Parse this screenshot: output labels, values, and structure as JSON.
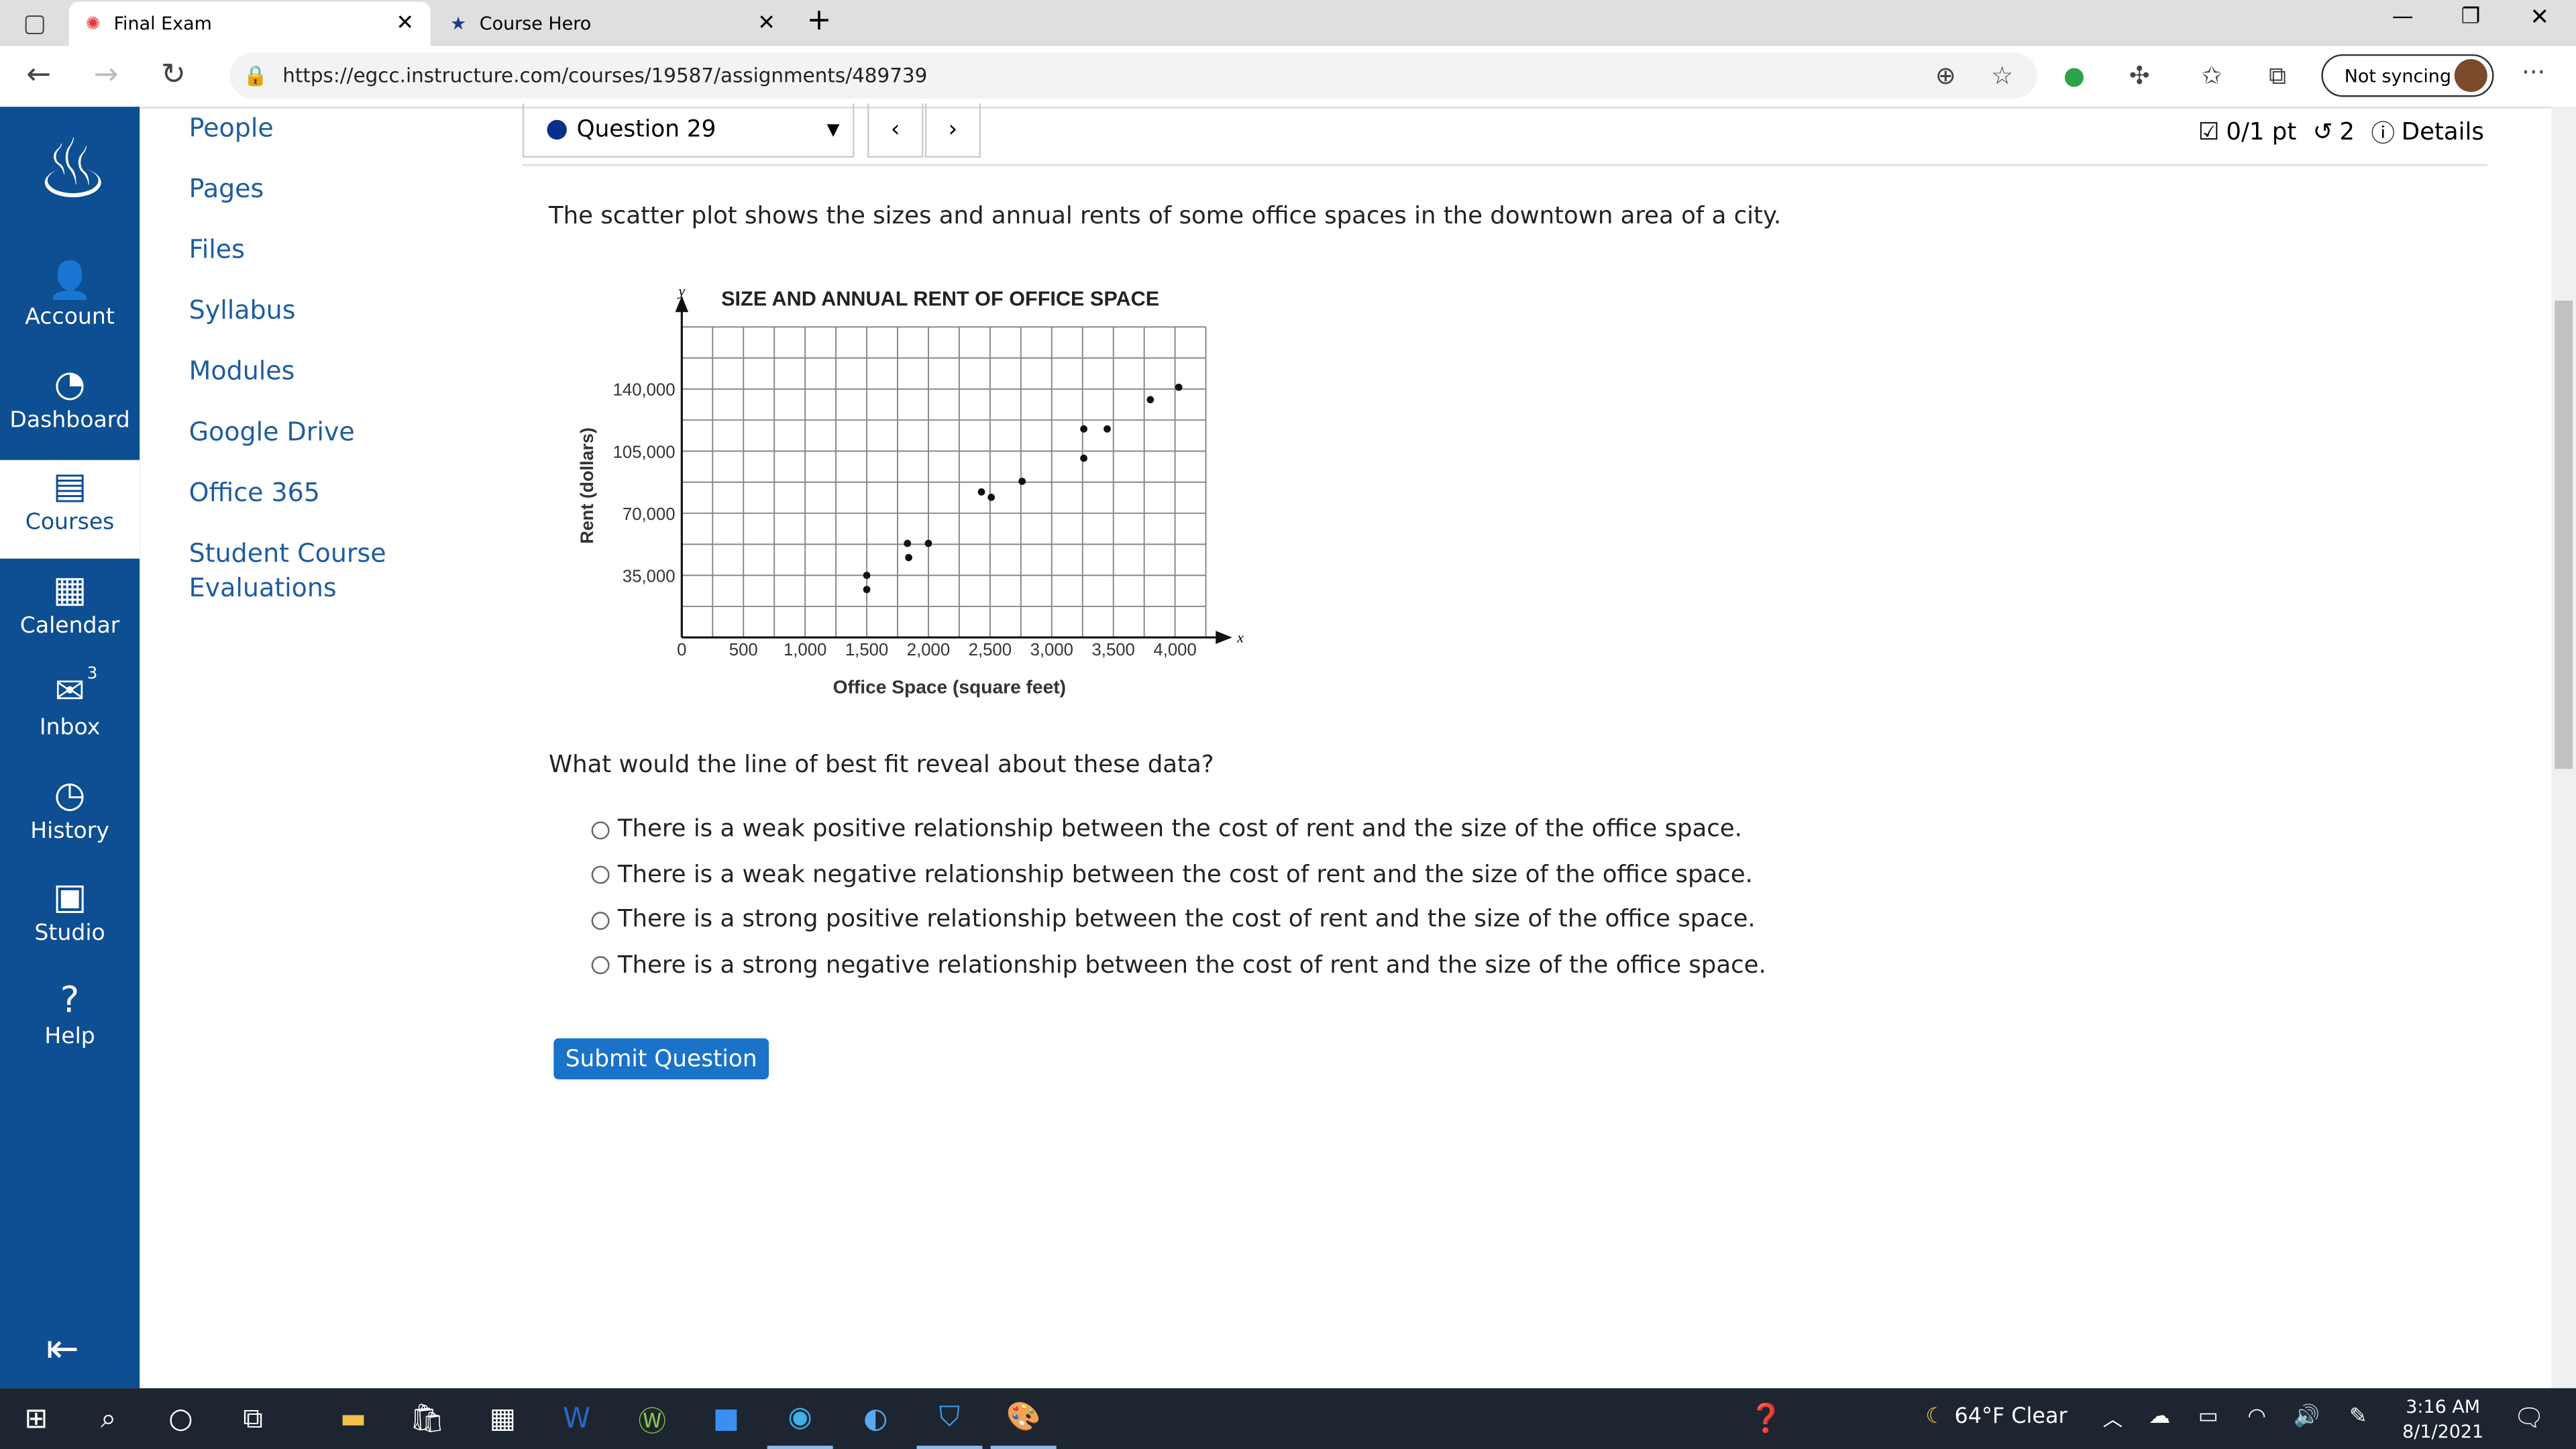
{
  "browser": {
    "tabs": [
      {
        "label": "Final Exam",
        "icon": "canvas-icon",
        "active": true
      },
      {
        "label": "Course Hero",
        "icon": "course-hero-icon",
        "active": false
      }
    ],
    "url": "https://egcc.instructure.com/courses/19587/assignments/489739",
    "sync_label": "Not syncing"
  },
  "global_nav": [
    {
      "label": "Account",
      "icon": "account-icon"
    },
    {
      "label": "Dashboard",
      "icon": "dashboard-icon"
    },
    {
      "label": "Courses",
      "icon": "courses-icon",
      "active": true
    },
    {
      "label": "Calendar",
      "icon": "calendar-icon"
    },
    {
      "label": "Inbox",
      "icon": "inbox-icon",
      "badge": "3"
    },
    {
      "label": "History",
      "icon": "history-icon"
    },
    {
      "label": "Studio",
      "icon": "studio-icon"
    },
    {
      "label": "Help",
      "icon": "help-icon"
    }
  ],
  "course_nav": [
    "People",
    "Pages",
    "Files",
    "Syllabus",
    "Modules",
    "Google Drive",
    "Office 365",
    "Student Course",
    "Evaluations"
  ],
  "quiz": {
    "question_select": "Question 29",
    "points": "0/1 pt",
    "attempts": "2",
    "details": "Details",
    "prompt": "The scatter plot shows the sizes and annual rents of some office spaces in the downtown area of a city.",
    "question": "What would the line of best fit reveal about these data?",
    "options": [
      "There is a weak positive relationship between the cost of rent and the size of the office space.",
      "There is a weak negative relationship between the cost of rent and the size of the office space.",
      "There is a strong positive relationship between the cost of rent and the size of the office space.",
      "There is a strong negative relationship between the cost of rent and the size of the office space."
    ],
    "submit": "Submit Question"
  },
  "chart_data": {
    "type": "scatter",
    "title": "SIZE AND ANNUAL RENT OF OFFICE SPACE",
    "xlabel": "Office Space (square feet)",
    "ylabel": "Rent (dollars)",
    "x_axis_letter": "x",
    "y_axis_letter": "y",
    "xlim": [
      0,
      4250
    ],
    "ylim": [
      0,
      175000
    ],
    "grid": true,
    "xticks": [
      "0",
      "500",
      "1,000",
      "1,500",
      "2,000",
      "2,500",
      "3,000",
      "3,500",
      "4,000"
    ],
    "yticks": [
      "35,000",
      "70,000",
      "105,000",
      "140,000"
    ],
    "points": [
      [
        1500,
        35000
      ],
      [
        1500,
        27000
      ],
      [
        1830,
        53000
      ],
      [
        1840,
        45000
      ],
      [
        2000,
        53000
      ],
      [
        2430,
        82000
      ],
      [
        2510,
        79000
      ],
      [
        2760,
        88000
      ],
      [
        3260,
        117500
      ],
      [
        3260,
        101000
      ],
      [
        3450,
        117500
      ],
      [
        3800,
        134000
      ],
      [
        4030,
        141000
      ]
    ]
  },
  "taskbar": {
    "weather": "64°F  Clear",
    "time": "3:16 AM",
    "date": "8/1/2021"
  }
}
